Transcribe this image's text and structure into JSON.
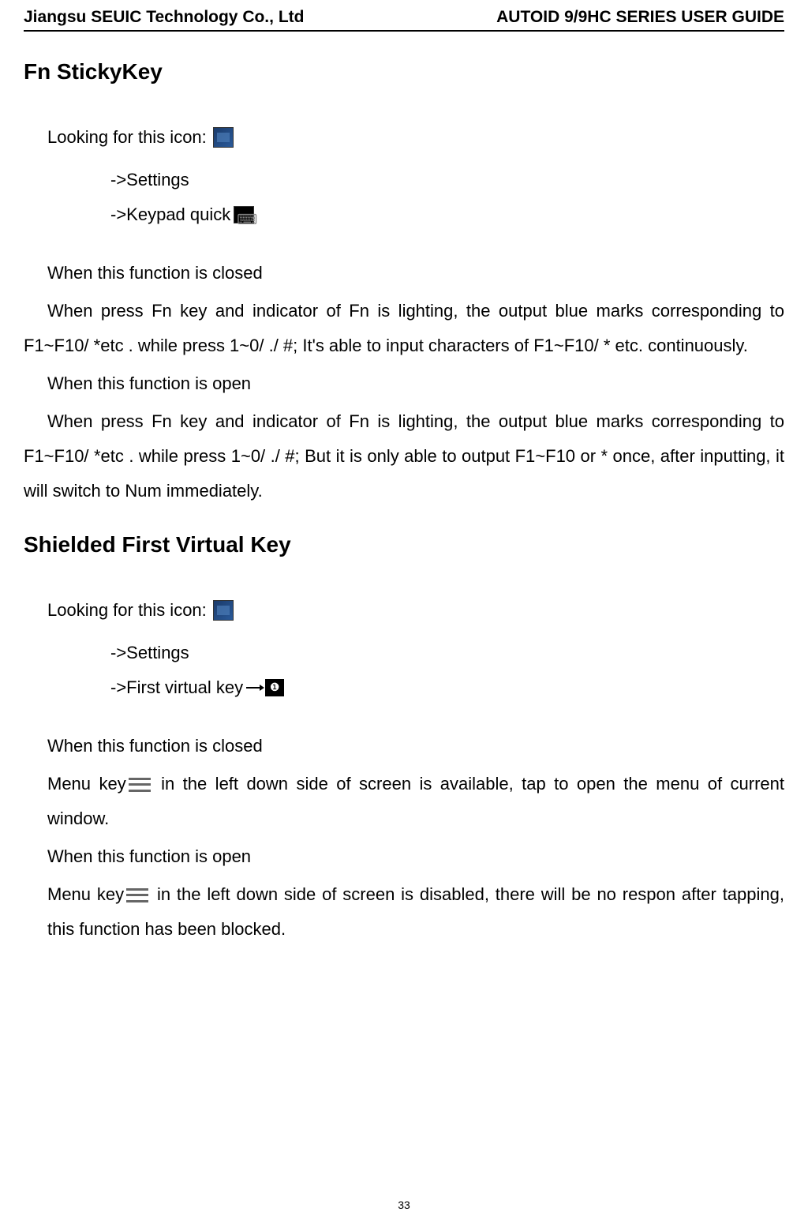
{
  "header": {
    "left": "Jiangsu SEUIC Technology Co., Ltd",
    "right": "AUTOID 9/9HC SERIES USER GUIDE"
  },
  "section1": {
    "title": "Fn StickyKey",
    "looking_text": "Looking for this icon:",
    "nav1": "->Settings",
    "nav2_prefix": "->Keypad quick",
    "closed_label": "When this function is closed",
    "closed_para": "When press Fn key and indicator of Fn is lighting, the output blue marks corresponding to F1~F10/ *etc . while press 1~0/ ./ #; It's able to input characters of   F1~F10/ * etc. continuously.",
    "open_label": "When this function is open",
    "open_para": "When press Fn key and indicator of Fn is lighting, the output blue marks corresponding to F1~F10/ *etc . while press 1~0/ ./ #; But it is only able to output F1~F10 or * once, after inputting, it will switch to Num immediately."
  },
  "section2": {
    "title": "Shielded First Virtual Key",
    "looking_text": "Looking for this icon:",
    "nav1": "->Settings",
    "nav2_prefix": "->First virtual key",
    "virtual_box_label": "❑",
    "closed_label": "When this function is closed",
    "closed_para_pre": "Menu key",
    "closed_para_post": " in the left down side of screen is available, tap to open the menu of current window.",
    "open_label": "When this function is open",
    "open_para_pre": "Menu key",
    "open_para_post": " in the left down side of screen is disabled, there will be no respon after tapping, this function has been blocked."
  },
  "page_number": "33"
}
